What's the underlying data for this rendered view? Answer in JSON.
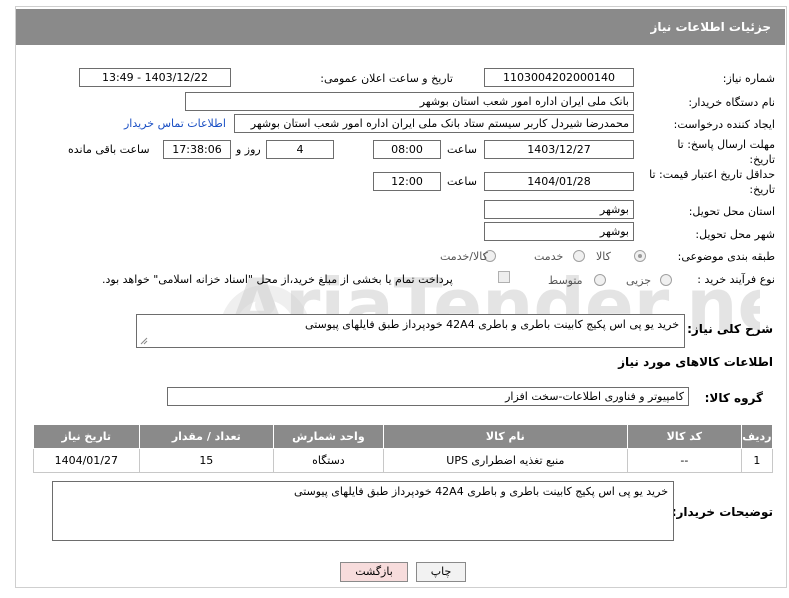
{
  "header": {
    "title": "جزئیات اطلاعات نیاز"
  },
  "watermark": {
    "text": "AriaTender.net"
  },
  "fields": {
    "need_number": {
      "label": "شماره نیاز:",
      "value": "1103004202000140"
    },
    "announce_datetime": {
      "label": "تاریخ و ساعت اعلان عمومی:",
      "value": "1403/12/22 - 13:49"
    },
    "buyer_org": {
      "label": "نام دستگاه خریدار:",
      "value": "بانک ملی ایران اداره امور شعب استان بوشهر"
    },
    "requester": {
      "label": "ایجاد کننده درخواست:",
      "value": "محمدرضا شیردل کاربر سیستم ستاد بانک ملی ایران اداره امور شعب استان بوشهر",
      "contact_link": "اطلاعات تماس خریدار"
    },
    "reply_deadline": {
      "label": "مهلت ارسال پاسخ: تا تاریخ:",
      "date": "1403/12/27",
      "time_label": "ساعت",
      "time": "08:00",
      "days": "4",
      "days_label": "روز و",
      "remaining_time": "17:38:06",
      "remaining_label": "ساعت باقی مانده"
    },
    "min_price_validity": {
      "label": "حداقل تاریخ اعتبار قیمت: تا تاریخ:",
      "date": "1404/01/28",
      "time_label": "ساعت",
      "time": "12:00"
    },
    "delivery_province": {
      "label": "استان محل تحویل:",
      "value": "بوشهر"
    },
    "delivery_city": {
      "label": "شهر محل تحویل:",
      "value": "بوشهر"
    },
    "category": {
      "label": "طبقه بندی موضوعی:",
      "options": [
        "کالا",
        "خدمت",
        "کالا/خدمت"
      ],
      "selected": "کالا"
    },
    "purchase_process": {
      "label": "نوع فرآیند خرید :",
      "options": [
        "جزیی",
        "متوسط"
      ],
      "payment_note": "پرداخت تمام یا بخشی از مبلغ خرید،از محل \"اسناد خزانه اسلامی\" خواهد بود."
    }
  },
  "description": {
    "label": "شرح کلی نیاز:",
    "value": "خرید یو پی اس پکیج کابینت باطری و باطری 42A4  خودپرداز طبق فایلهای پیوستی"
  },
  "goods_section": {
    "title": "اطلاعات کالاهای مورد نیاز",
    "group_label": "گروه کالا:",
    "group_value": "کامپیوتر و فناوری اطلاعات-سخت افزار"
  },
  "table": {
    "columns": [
      "ردیف",
      "کد کالا",
      "نام کالا",
      "واحد شمارش",
      "تعداد / مقدار",
      "تاریخ نیاز"
    ],
    "rows": [
      [
        "1",
        "--",
        "منبع تغذیه اضطراری UPS",
        "دستگاه",
        "15",
        "1404/01/27"
      ]
    ]
  },
  "buyer_notes": {
    "label": "توضیحات خریدار:",
    "value": "خرید یو پی اس پکیج کابینت باطری و باطری 42A4  خودپرداز طبق فایلهای پیوستی"
  },
  "buttons": {
    "print": "چاپ",
    "back": "بازگشت"
  },
  "colors": {
    "header_bg": "#8a8a8a",
    "link": "#1a4fc4",
    "back_button_bg": "#f7dcdc"
  }
}
